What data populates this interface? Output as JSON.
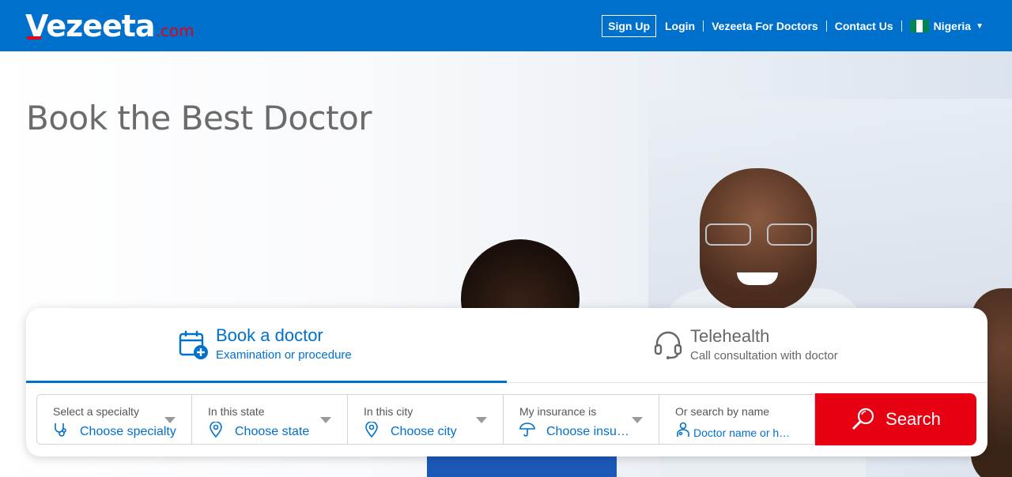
{
  "header": {
    "logo_text": "Vezeeta",
    "logo_suffix": ".com",
    "nav": {
      "sign_up": "Sign Up",
      "login": "Login",
      "for_doctors": "Vezeeta For Doctors",
      "contact": "Contact Us",
      "country": "Nigeria"
    }
  },
  "hero": {
    "title": "Book the Best Doctor"
  },
  "tabs": [
    {
      "title": "Book a doctor",
      "subtitle": "Examination or procedure",
      "icon": "calendar-plus-icon",
      "active": true
    },
    {
      "title": "Telehealth",
      "subtitle": "Call consultation with doctor",
      "icon": "headset-icon",
      "active": false
    }
  ],
  "filters": [
    {
      "label": "Select a specialty",
      "value": "Choose specialty",
      "icon": "stethoscope-icon"
    },
    {
      "label": "In this state",
      "value": "Choose state",
      "icon": "location-pin-icon"
    },
    {
      "label": "In this city",
      "value": "Choose city",
      "icon": "location-pin-icon"
    },
    {
      "label": "My insurance is",
      "value": "Choose insu…",
      "icon": "umbrella-icon"
    },
    {
      "label": "Or search by name",
      "placeholder": "Doctor name or h…",
      "icon": "doctor-icon"
    }
  ],
  "search": {
    "label": "Search",
    "icon": "search-icon"
  },
  "colors": {
    "brand_blue": "#0070cd",
    "brand_red": "#e60012"
  }
}
